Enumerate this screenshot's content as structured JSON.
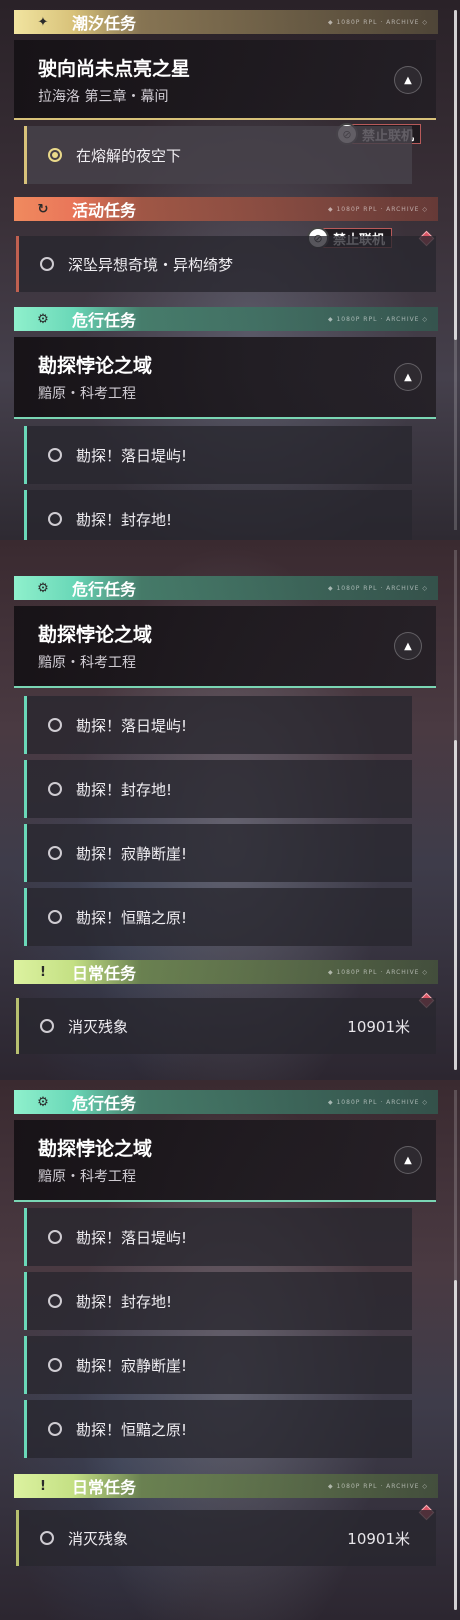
{
  "categories": {
    "tide": {
      "label": "潮汐任务",
      "icon": "sparkle-icon"
    },
    "event": {
      "label": "活动任务",
      "icon": "refresh-icon"
    },
    "danger": {
      "label": "危行任务",
      "icon": "gear-icon"
    },
    "daily": {
      "label": "日常任务",
      "icon": "exclamation-icon"
    }
  },
  "deco_text": "◆ 1080P RPL · ARCHIVE ◇",
  "tide_quest": {
    "title": "驶向尚未点亮之星",
    "subtitle": "拉海洛 第三章・幕间",
    "step": "在熔解的夜空下"
  },
  "event_quest": {
    "step": "深坠异想奇境・异构绮梦"
  },
  "danger_quest": {
    "title": "勘探悖论之域",
    "subtitle": "黯原・科考工程",
    "steps": [
      "勘探！落日堤屿!",
      "勘探！封存地!",
      "勘探！寂静断崖!",
      "勘探！恒黯之原!"
    ]
  },
  "daily_quest": {
    "step": "消灭残象",
    "distance": "10901米"
  },
  "badge": {
    "label": "禁止联机"
  },
  "colors": {
    "gold": "#d8c27a",
    "orange": "#e9765a",
    "teal": "#6ad8b8",
    "lime": "#c4e084",
    "warning": "#d95464"
  }
}
